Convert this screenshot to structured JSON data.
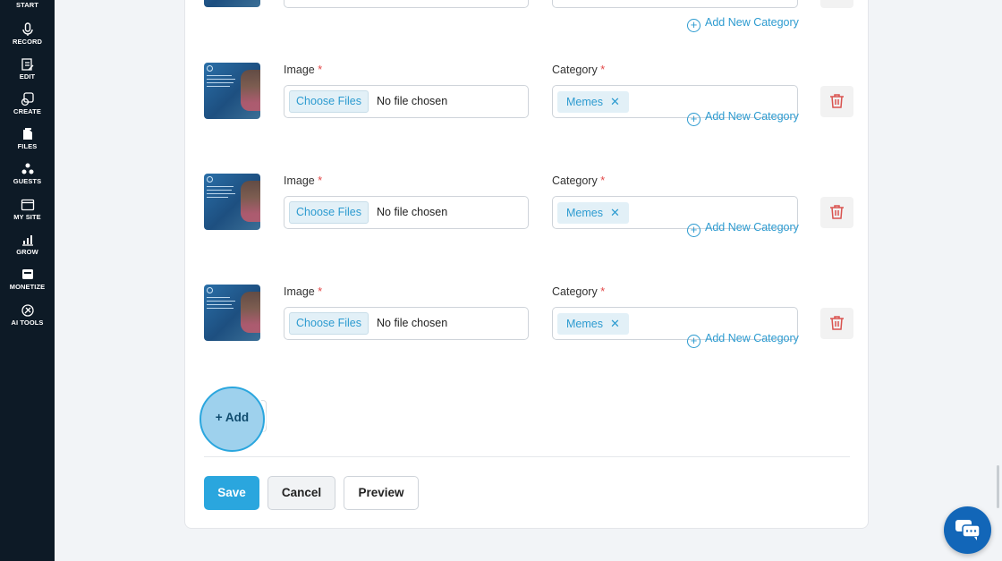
{
  "sidebar": {
    "items": [
      {
        "label": "START",
        "icon": "rocket-icon"
      },
      {
        "label": "RECORD",
        "icon": "microphone-icon"
      },
      {
        "label": "EDIT",
        "icon": "edit-icon"
      },
      {
        "label": "CREATE",
        "icon": "create-icon"
      },
      {
        "label": "FILES",
        "icon": "files-icon"
      },
      {
        "label": "GUESTS",
        "icon": "guests-icon"
      },
      {
        "label": "MY SITE",
        "icon": "browser-icon"
      },
      {
        "label": "GROW",
        "icon": "chart-icon"
      },
      {
        "label": "MONETIZE",
        "icon": "monetize-icon"
      },
      {
        "label": "AI TOOLS",
        "icon": "ai-tools-icon"
      }
    ]
  },
  "form": {
    "add_category_label": "Add New Category",
    "rows": [
      {
        "image_label": "Image",
        "category_label": "Category",
        "required_mark": "*",
        "choose_files": "Choose Files",
        "file_status": "No file chosen",
        "category_chip": "Memes"
      },
      {
        "image_label": "Image",
        "category_label": "Category",
        "required_mark": "*",
        "choose_files": "Choose Files",
        "file_status": "No file chosen",
        "category_chip": "Memes"
      },
      {
        "image_label": "Image",
        "category_label": "Category",
        "required_mark": "*",
        "choose_files": "Choose Files",
        "file_status": "No file chosen",
        "category_chip": "Memes"
      }
    ],
    "add_label": "+ Add",
    "save_label": "Save",
    "cancel_label": "Cancel",
    "preview_label": "Preview"
  },
  "colors": {
    "sidebar_bg": "#0d1a26",
    "accent": "#2aa6de",
    "delete": "#d9534f",
    "chat": "#1266b8"
  }
}
